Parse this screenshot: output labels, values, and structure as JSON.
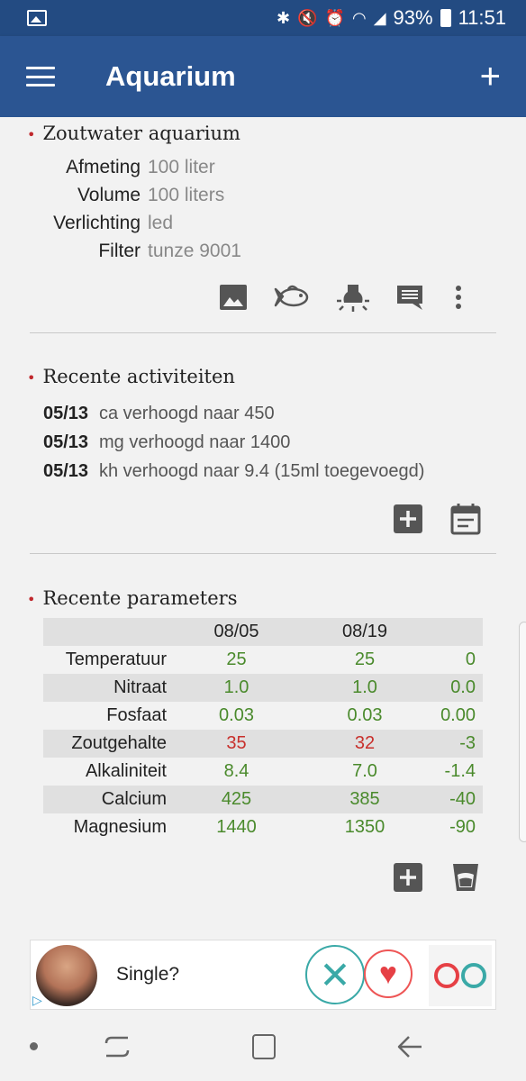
{
  "statusbar": {
    "battery": "93%",
    "time": "11:51",
    "icons": [
      "image-icon",
      "bluetooth-icon",
      "mute-icon",
      "alarm-icon",
      "wifi-icon",
      "signal-icon",
      "battery-icon"
    ]
  },
  "appbar": {
    "title": "Aquarium",
    "menu_icon": "hamburger-icon",
    "add_icon": "plus-icon"
  },
  "aquarium": {
    "title": "Zoutwater aquarium",
    "rows": [
      {
        "label": "Afmeting",
        "value": "100 liter"
      },
      {
        "label": "Volume",
        "value": "100 liters"
      },
      {
        "label": "Verlichting",
        "value": "led"
      },
      {
        "label": "Filter",
        "value": "tunze 9001"
      }
    ],
    "actions": [
      "photo-icon",
      "fish-icon",
      "light-icon",
      "comment-icon",
      "more-vert-icon"
    ]
  },
  "activities": {
    "title": "Recente activiteiten",
    "items": [
      {
        "date": "05/13",
        "text": "ca verhoogd naar 450"
      },
      {
        "date": "05/13",
        "text": "mg verhoogd naar 1400"
      },
      {
        "date": "05/13",
        "text": "kh verhoogd naar 9.4 (15ml toegevoegd)"
      }
    ],
    "actions": [
      "add-box-icon",
      "calendar-icon"
    ]
  },
  "parameters": {
    "title": "Recente parameters",
    "headers": [
      "",
      "08/05",
      "08/19",
      ""
    ],
    "rows": [
      {
        "name": "Temperatuur",
        "v1": "25",
        "v2": "25",
        "diff": "0",
        "status": "good"
      },
      {
        "name": "Nitraat",
        "v1": "1.0",
        "v2": "1.0",
        "diff": "0.0",
        "status": "good"
      },
      {
        "name": "Fosfaat",
        "v1": "0.03",
        "v2": "0.03",
        "diff": "0.00",
        "status": "good"
      },
      {
        "name": "Zoutgehalte",
        "v1": "35",
        "v2": "32",
        "diff": "-3",
        "status": "bad"
      },
      {
        "name": "Alkaliniteit",
        "v1": "8.4",
        "v2": "7.0",
        "diff": "-1.4",
        "status": "good"
      },
      {
        "name": "Calcium",
        "v1": "425",
        "v2": "385",
        "diff": "-40",
        "status": "good"
      },
      {
        "name": "Magnesium",
        "v1": "1440",
        "v2": "1350",
        "diff": "-90",
        "status": "good"
      }
    ],
    "actions": [
      "add-box-icon",
      "cup-icon"
    ],
    "colors": {
      "good": "#4a8a2c",
      "bad": "#c8302c"
    }
  },
  "ad": {
    "text": "Single?"
  },
  "navbar": {
    "icons": [
      "dot-icon",
      "recents-icon",
      "home-icon",
      "back-icon"
    ]
  }
}
